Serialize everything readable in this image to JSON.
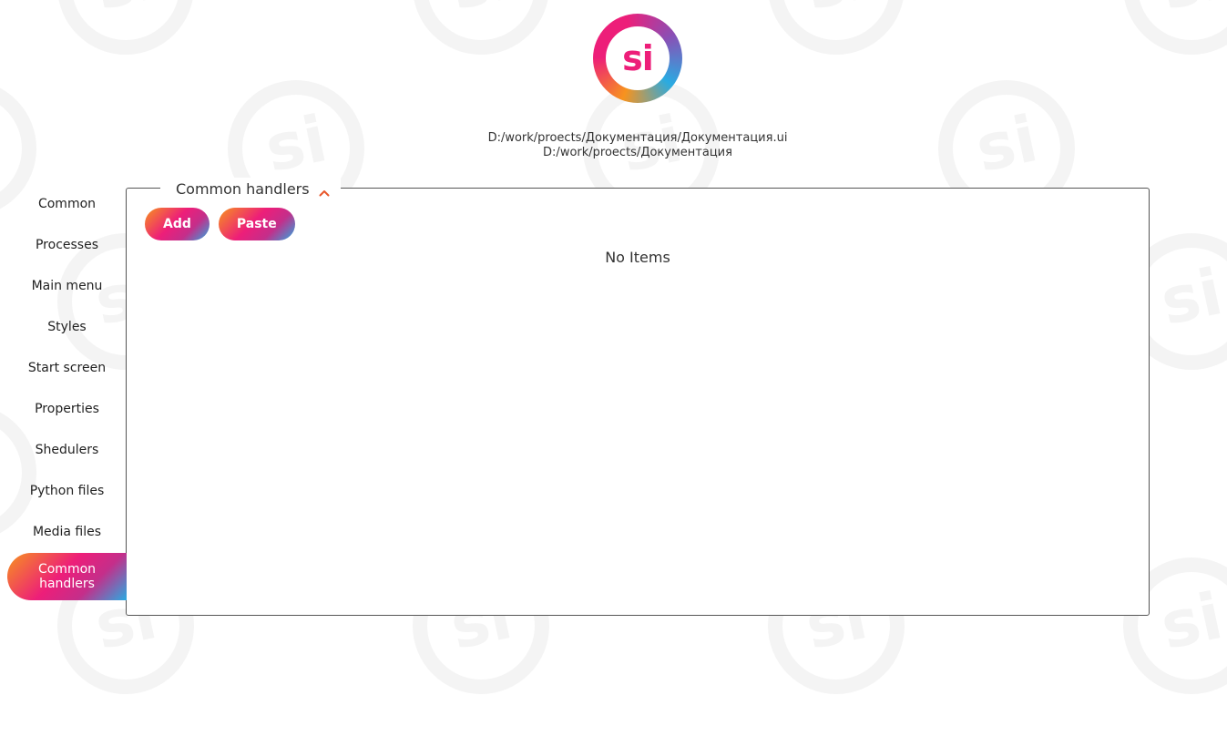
{
  "logo": {
    "text": "si"
  },
  "project": {
    "ui_path": "D:/work/proects/Документация/Документация.ui",
    "folder_path": "D:/work/proects/Документация"
  },
  "sidebar": {
    "items": [
      {
        "label": "Common",
        "active": false
      },
      {
        "label": "Processes",
        "active": false
      },
      {
        "label": "Main menu",
        "active": false
      },
      {
        "label": "Styles",
        "active": false
      },
      {
        "label": "Start screen",
        "active": false
      },
      {
        "label": "Properties",
        "active": false
      },
      {
        "label": "Shedulers",
        "active": false
      },
      {
        "label": "Python files",
        "active": false
      },
      {
        "label": "Media files",
        "active": false
      },
      {
        "label": "Common handlers",
        "active": true
      }
    ]
  },
  "panel": {
    "title": "Common handlers",
    "collapse_icon": "chevron-up-icon",
    "add_label": "Add",
    "paste_label": "Paste",
    "empty_text": "No Items"
  },
  "colors": {
    "gradient_start": "#f7931e",
    "gradient_mid": "#ed1e79",
    "gradient_end": "#29abe2",
    "chevron": "#e8572a",
    "watermark": "#f4f4f4"
  }
}
